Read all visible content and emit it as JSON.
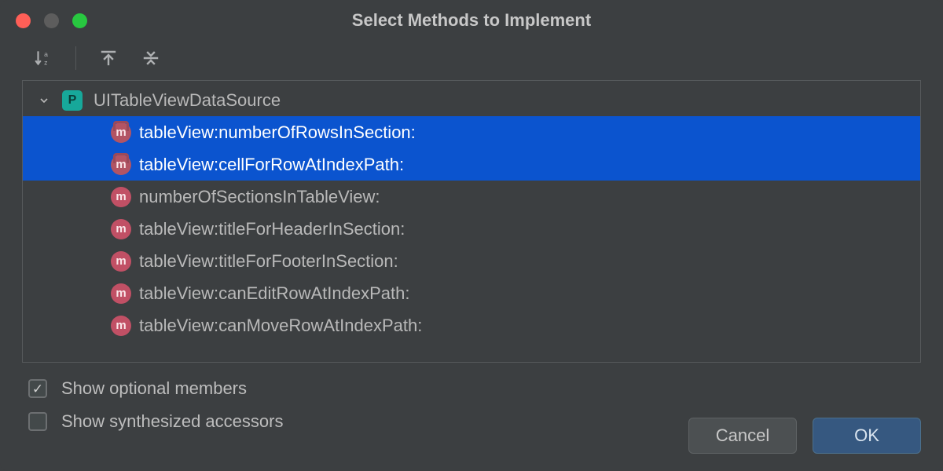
{
  "title": "Select Methods to Implement",
  "toolbar": {
    "sort_icon": "sort-az-icon",
    "expand_icon": "expand-all-icon",
    "collapse_icon": "collapse-all-icon"
  },
  "tree": {
    "protocol_badge_letter": "P",
    "protocol_name": "UITableViewDataSource",
    "method_badge_letter": "m",
    "methods": [
      {
        "label": "tableView:numberOfRowsInSection:",
        "selected": true,
        "required": true
      },
      {
        "label": "tableView:cellForRowAtIndexPath:",
        "selected": true,
        "required": true
      },
      {
        "label": "numberOfSectionsInTableView:",
        "selected": false,
        "required": false
      },
      {
        "label": "tableView:titleForHeaderInSection:",
        "selected": false,
        "required": false
      },
      {
        "label": "tableView:titleForFooterInSection:",
        "selected": false,
        "required": false
      },
      {
        "label": "tableView:canEditRowAtIndexPath:",
        "selected": false,
        "required": false
      },
      {
        "label": "tableView:canMoveRowAtIndexPath:",
        "selected": false,
        "required": false
      }
    ]
  },
  "checkboxes": {
    "optional_label": "Show optional members",
    "optional_checked": true,
    "synthesized_label": "Show synthesized accessors",
    "synthesized_checked": false
  },
  "buttons": {
    "cancel": "Cancel",
    "ok": "OK"
  }
}
